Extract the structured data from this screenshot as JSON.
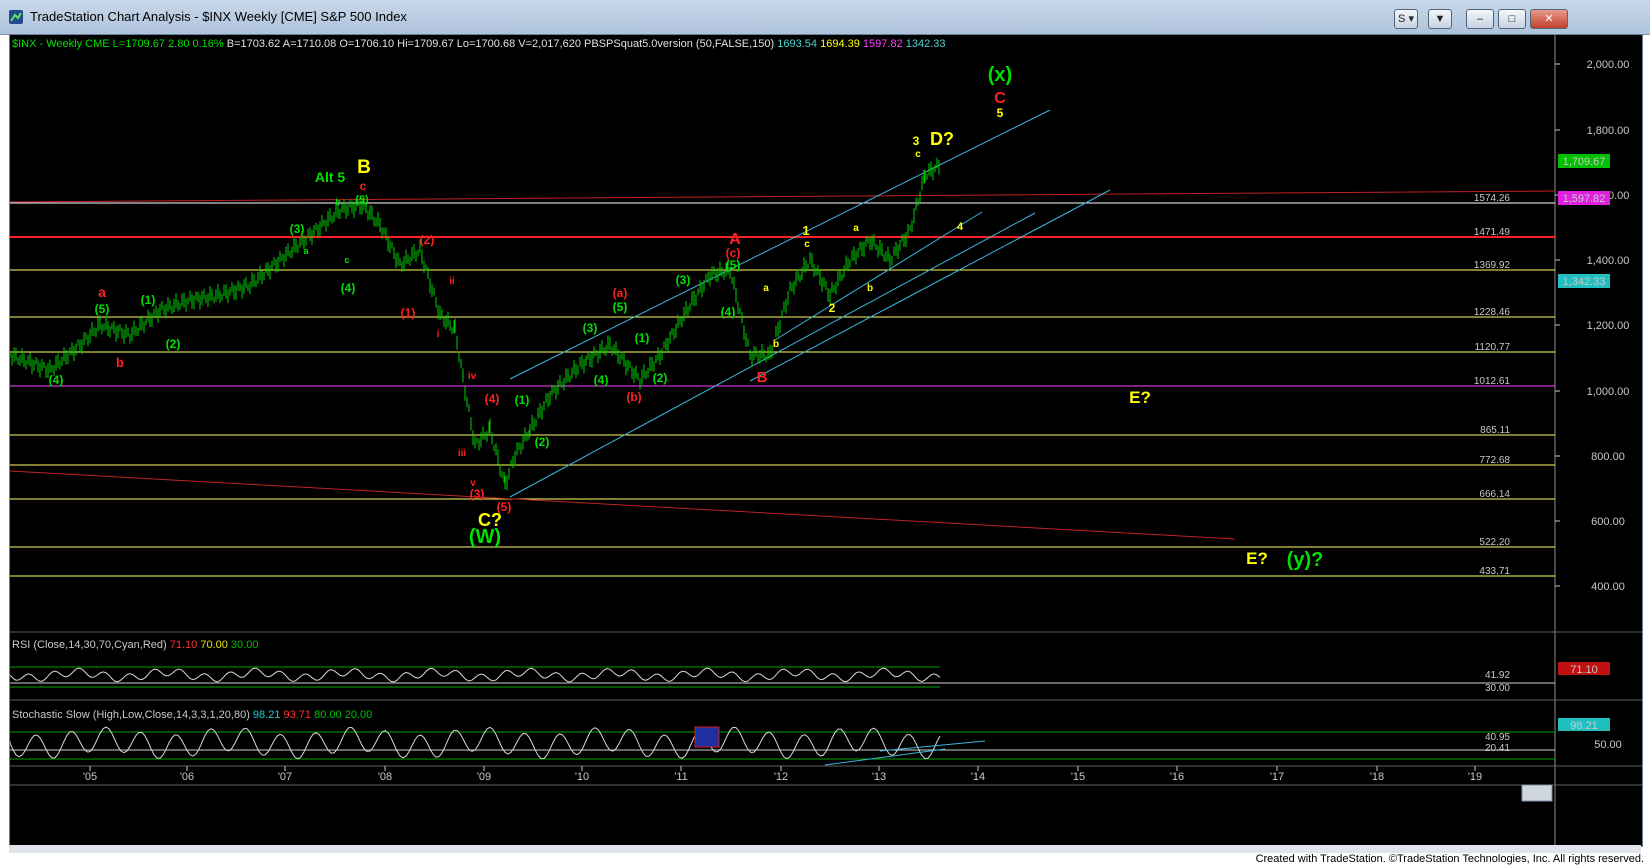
{
  "window": {
    "title": "TradeStation Chart Analysis - $INX Weekly [CME] S&P 500 Index",
    "buttons": [
      "S",
      "▼",
      "–",
      "□",
      "✕"
    ]
  },
  "header": {
    "parts": [
      {
        "text": "$INX - Weekly  CME",
        "color": "#00e000"
      },
      {
        "text": "L=1709.67",
        "color": "#00e000"
      },
      {
        "text": "2.80",
        "color": "#00e000"
      },
      {
        "text": "0.16%",
        "color": "#00e000"
      },
      {
        "text": "B=1703.62",
        "color": "#e0e0e0"
      },
      {
        "text": "A=1710.08",
        "color": "#e0e0e0"
      },
      {
        "text": "O=1706.10",
        "color": "#e0e0e0"
      },
      {
        "text": "Hi=1709.67",
        "color": "#e0e0e0"
      },
      {
        "text": "Lo=1700.68",
        "color": "#e0e0e0"
      },
      {
        "text": "V=2,017,620",
        "color": "#e0e0e0"
      },
      {
        "text": "PBSPSquat5.0version (50,FALSE,150)",
        "color": "#e0e0e0"
      },
      {
        "text": "1693.54",
        "color": "#4fd1d1"
      },
      {
        "text": "1694.39",
        "color": "#ffff00"
      },
      {
        "text": "1597.82",
        "color": "#ff40ff"
      },
      {
        "text": "1342.33",
        "color": "#4fd1d1"
      }
    ]
  },
  "price_axis": {
    "ticks": [
      "2,000.00",
      "1,800.00",
      "1,600.00",
      "1,400.00",
      "1,200.00",
      "1,000.00",
      "800.00",
      "600.00",
      "400.00"
    ]
  },
  "horizontal_levels": [
    {
      "label": "1574.26",
      "color": "#ffffff"
    },
    {
      "label": "1471.49",
      "color": "#ff2020"
    },
    {
      "label": "1369.92",
      "color": "#ffff60"
    },
    {
      "label": "1228.46",
      "color": "#ffff60"
    },
    {
      "label": "1120.77",
      "color": "#ffff60"
    },
    {
      "label": "1012.61",
      "color": "#ff40ff"
    },
    {
      "label": "865.11",
      "color": "#ffff60"
    },
    {
      "label": "772.68",
      "color": "#ffff60"
    },
    {
      "label": "666.14",
      "color": "#ffff60"
    },
    {
      "label": "522.20",
      "color": "#ffff60"
    },
    {
      "label": "433.71",
      "color": "#ffff60"
    }
  ],
  "price_badges": [
    {
      "label": "1,709.67",
      "bg": "#00c000",
      "fg": "#000000"
    },
    {
      "label": "1,597.82",
      "bg": "#e020e0",
      "fg": "#000000"
    },
    {
      "label": "1,342.33",
      "bg": "#20c0c0",
      "fg": "#000000"
    }
  ],
  "time_axis": {
    "labels": [
      "'05",
      "'06",
      "'07",
      "'08",
      "'09",
      "'10",
      "'11",
      "'12",
      "'13",
      "'14",
      "'15",
      "'16",
      "'17",
      "'18",
      "'19"
    ]
  },
  "wave_labels": [
    {
      "text": "(x)",
      "color": "#00e000"
    },
    {
      "text": "C",
      "color": "#ff2020"
    },
    {
      "text": "5",
      "color": "#ffff00"
    },
    {
      "text": "3",
      "color": "#ffff00"
    },
    {
      "text": "D?",
      "color": "#ffff00"
    },
    {
      "text": "c",
      "color": "#ffff00"
    },
    {
      "text": "4",
      "color": "#ffff00"
    },
    {
      "text": "B",
      "color": "#ffff00"
    },
    {
      "text": "Alt 5",
      "color": "#00e000"
    },
    {
      "text": "c",
      "color": "#ff2020"
    },
    {
      "text": "(5)",
      "color": "#00e000"
    },
    {
      "text": "b",
      "color": "#00e000"
    },
    {
      "text": "(3)",
      "color": "#00e000"
    },
    {
      "text": "a",
      "color": "#00e000"
    },
    {
      "text": "c",
      "color": "#00e000"
    },
    {
      "text": "(4)",
      "color": "#00e000"
    },
    {
      "text": "(2)",
      "color": "#ff2020"
    },
    {
      "text": "ii",
      "color": "#ff2020"
    },
    {
      "text": "(1)",
      "color": "#ff2020"
    },
    {
      "text": "i",
      "color": "#ff2020"
    },
    {
      "text": "a",
      "color": "#ff2020"
    },
    {
      "text": "(5)",
      "color": "#00e000"
    },
    {
      "text": "(1)",
      "color": "#00e000"
    },
    {
      "text": "(2)",
      "color": "#00e000"
    },
    {
      "text": "b",
      "color": "#ff2020"
    },
    {
      "text": "(4)",
      "color": "#00e000"
    },
    {
      "text": "iv",
      "color": "#ff2020"
    },
    {
      "text": "(4)",
      "color": "#ff2020"
    },
    {
      "text": "iii",
      "color": "#ff2020"
    },
    {
      "text": "v",
      "color": "#ff2020"
    },
    {
      "text": "(3)",
      "color": "#ff2020"
    },
    {
      "text": "(5)",
      "color": "#ff2020"
    },
    {
      "text": "C?",
      "color": "#ffff00"
    },
    {
      "text": "(W)",
      "color": "#00e000"
    },
    {
      "text": "(1)",
      "color": "#00e000"
    },
    {
      "text": "(2)",
      "color": "#00e000"
    },
    {
      "text": "(3)",
      "color": "#00e000"
    },
    {
      "text": "(4)",
      "color": "#00e000"
    },
    {
      "text": "(a)",
      "color": "#ff2020"
    },
    {
      "text": "(5)",
      "color": "#00e000"
    },
    {
      "text": "(1)",
      "color": "#00e000"
    },
    {
      "text": "(2)",
      "color": "#00e000"
    },
    {
      "text": "(b)",
      "color": "#ff2020"
    },
    {
      "text": "(3)",
      "color": "#00e000"
    },
    {
      "text": "A",
      "color": "#ff2020"
    },
    {
      "text": "(c)",
      "color": "#ff2020"
    },
    {
      "text": "(5)",
      "color": "#00e000"
    },
    {
      "text": "(4)",
      "color": "#00e000"
    },
    {
      "text": "B",
      "color": "#ff2020"
    },
    {
      "text": "a",
      "color": "#ffff00"
    },
    {
      "text": "b",
      "color": "#ffff00"
    },
    {
      "text": "1",
      "color": "#ffff00"
    },
    {
      "text": "c",
      "color": "#ffff00"
    },
    {
      "text": "2",
      "color": "#ffff00"
    },
    {
      "text": "a",
      "color": "#ffff00"
    },
    {
      "text": "b",
      "color": "#ffff00"
    },
    {
      "text": "E?",
      "color": "#ffff00"
    },
    {
      "text": "E?",
      "color": "#ffff00"
    },
    {
      "text": "(y)?",
      "color": "#00e000"
    }
  ],
  "rsi": {
    "title": "RSI (Close,14,30,70,Cyan,Red)",
    "values": [
      {
        "text": "71.10",
        "color": "#ff3030"
      },
      {
        "text": "70.00",
        "color": "#e0e000"
      },
      {
        "text": "30.00",
        "color": "#00c000"
      }
    ],
    "axis": [
      "41.92",
      "30.00"
    ],
    "badge": "71.10"
  },
  "stochastic": {
    "title": "Stochastic Slow (High,Low,Close,14,3,3,1,20,80)",
    "values": [
      {
        "text": "98.21",
        "color": "#20d0d0"
      },
      {
        "text": "93.71",
        "color": "#ff3030"
      },
      {
        "text": "80.00",
        "color": "#00c000"
      },
      {
        "text": "20.00",
        "color": "#00c000"
      }
    ],
    "axis": [
      "40.95",
      "20.41",
      "50.00"
    ],
    "badge": "98.21"
  },
  "footer": "Created with TradeStation. ©TradeStation Technologies, Inc. All rights reserved."
}
